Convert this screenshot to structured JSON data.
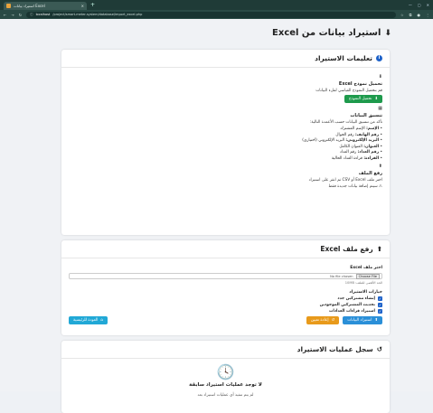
{
  "browser": {
    "tab_title": "استيراد بيانات Excel",
    "tab_close": "×",
    "new_tab": "+",
    "url_host": "localhost",
    "url_path": "/project/smart-meter-system/database/import_excel.php",
    "window_controls": [
      "—",
      "▢",
      "✕"
    ]
  },
  "page": {
    "title": "استيراد بيانات من Excel"
  },
  "instructions": {
    "heading": "تعليمات الاستيراد",
    "template_title": "تحميل نموذج Excel",
    "template_text": "قم بتحميل النموذج القياسي لملء البيانات",
    "template_button": "تحميل النموذج",
    "format_title": "تنسيق البيانات",
    "format_text": "تأكد من تنسيق البيانات حسب الأعمدة التالية:",
    "fields": [
      {
        "name": "الإسم:",
        "desc": "الإسم المشترك"
      },
      {
        "name": "رقم الهاتف:",
        "desc": "رقم الجوال"
      },
      {
        "name": "البريد الإلكتروني:",
        "desc": "البريد الإلكتروني (اختياري)"
      },
      {
        "name": "العنوان:",
        "desc": "العنوان الكامل"
      },
      {
        "name": "رقم العداد:",
        "desc": "رقم العداد"
      },
      {
        "name": "القراءة:",
        "desc": "قراءة العداد الحالية"
      }
    ],
    "upload_title": "رفع الملف",
    "upload_text": "اختر ملف Excel أو CSV ثم انقر على استيراد",
    "upload_warning": "سيتم إضافة بيانات جديدة فقط"
  },
  "upload": {
    "heading": "رفع ملف Excel",
    "file_label": "اختر ملف Excel",
    "file_status": "No file chosen",
    "choose_button": "Choose File",
    "hint": "الحد الأقصى للملف: 10MB",
    "options_title": "خيارات الاستيراد",
    "options": [
      {
        "label": "إنشاء مشتركين جدد",
        "checked": true
      },
      {
        "label": "تحديث المشتركين الموجودين",
        "checked": true
      },
      {
        "label": "استيراد قراءات العدادات",
        "checked": true
      }
    ],
    "import_button": "استيراد البيانات",
    "reset_button": "إعادة تعيين",
    "home_button": "العودة للرئيسية"
  },
  "history": {
    "heading": "سجل عمليات الاستيراد",
    "empty_title": "لا توجد عمليات استيراد سابقة",
    "empty_text": "لم يتم تنفيذ أي عمليات استيراد بعد"
  }
}
